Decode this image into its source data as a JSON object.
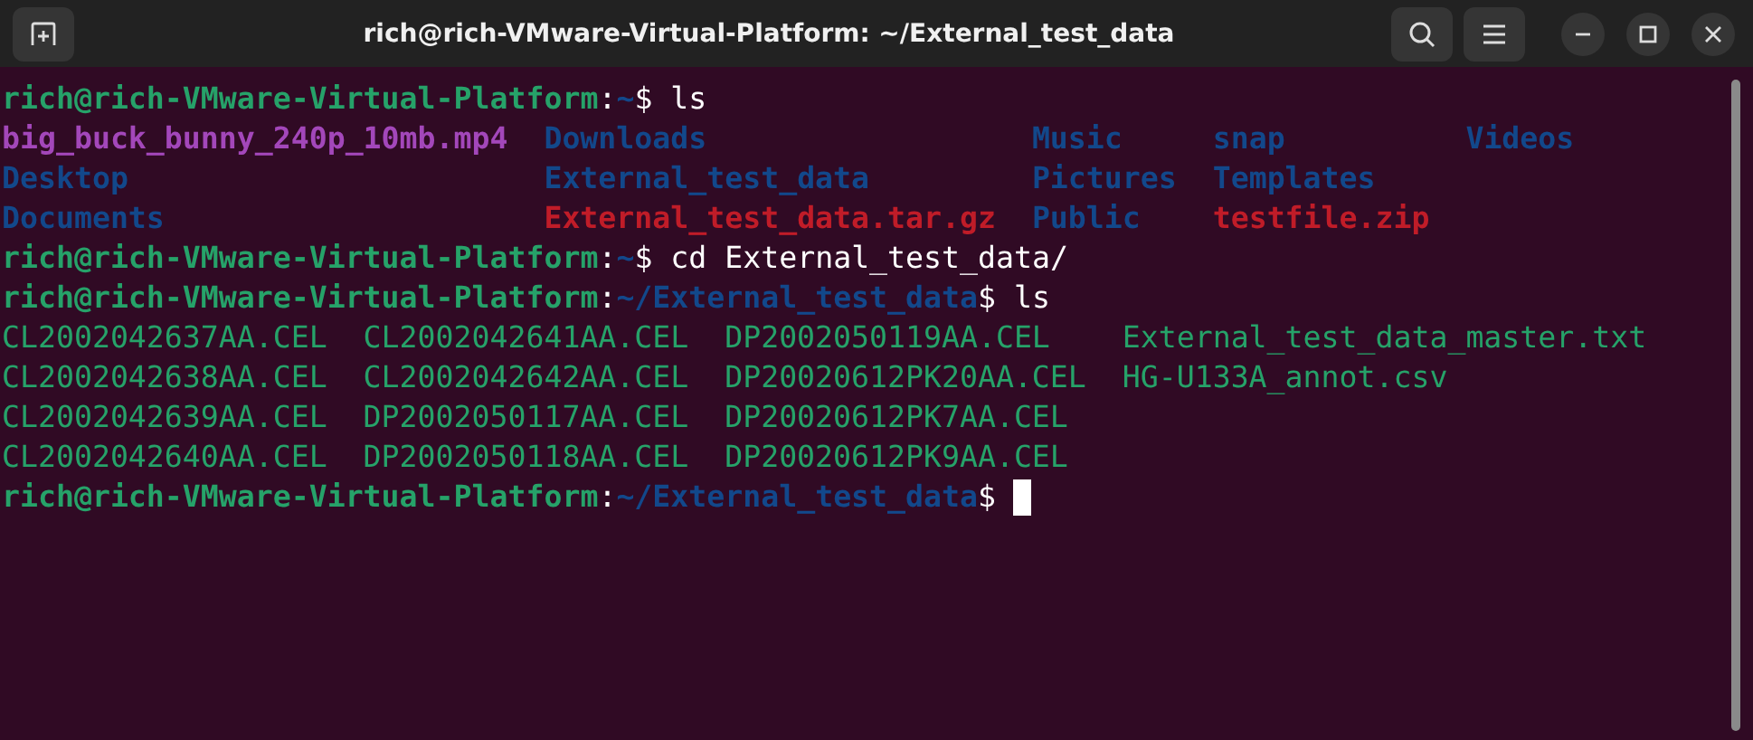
{
  "window": {
    "title": "rich@rich-VMware-Virtual-Platform: ~/External_test_data"
  },
  "lines": [
    {
      "kind": "prompt",
      "segments": [
        {
          "kind": "user",
          "text": "rich@rich-VMware-Virtual-Platform"
        },
        {
          "kind": "plain",
          "text": ":"
        },
        {
          "kind": "path",
          "text": "~"
        },
        {
          "kind": "plain",
          "text": "$ ls"
        }
      ]
    },
    {
      "kind": "listing",
      "rows": [
        [
          {
            "kind": "media",
            "text": "big_buck_bunny_240p_10mb.mp4"
          },
          {
            "kind": "dir",
            "text": "Downloads"
          },
          {
            "kind": "dir",
            "text": "Music"
          },
          {
            "kind": "dir",
            "text": "snap"
          },
          {
            "kind": "dir",
            "text": "Videos"
          }
        ],
        [
          {
            "kind": "dir",
            "text": "Desktop"
          },
          {
            "kind": "dir",
            "text": "External_test_data"
          },
          {
            "kind": "dir",
            "text": "Pictures"
          },
          {
            "kind": "dir",
            "text": "Templates"
          }
        ],
        [
          {
            "kind": "dir",
            "text": "Documents"
          },
          {
            "kind": "archive",
            "text": "External_test_data.tar.gz"
          },
          {
            "kind": "dir",
            "text": "Public"
          },
          {
            "kind": "archive",
            "text": "testfile.zip"
          }
        ]
      ]
    },
    {
      "kind": "prompt",
      "segments": [
        {
          "kind": "user",
          "text": "rich@rich-VMware-Virtual-Platform"
        },
        {
          "kind": "plain",
          "text": ":"
        },
        {
          "kind": "path",
          "text": "~"
        },
        {
          "kind": "plain",
          "text": "$ cd External_test_data/"
        }
      ]
    },
    {
      "kind": "prompt",
      "segments": [
        {
          "kind": "user",
          "text": "rich@rich-VMware-Virtual-Platform"
        },
        {
          "kind": "plain",
          "text": ":"
        },
        {
          "kind": "path",
          "text": "~/External_test_data"
        },
        {
          "kind": "plain",
          "text": "$ ls"
        }
      ]
    },
    {
      "kind": "listing",
      "rows": [
        [
          {
            "kind": "file",
            "text": "CL2002042637AA.CEL"
          },
          {
            "kind": "file",
            "text": "CL2002042641AA.CEL"
          },
          {
            "kind": "file",
            "text": "DP2002050119AA.CEL"
          },
          {
            "kind": "file",
            "text": "External_test_data_master.txt"
          }
        ],
        [
          {
            "kind": "file",
            "text": "CL2002042638AA.CEL"
          },
          {
            "kind": "file",
            "text": "CL2002042642AA.CEL"
          },
          {
            "kind": "file",
            "text": "DP20020612PK20AA.CEL"
          },
          {
            "kind": "file",
            "text": "HG-U133A_annot.csv"
          }
        ],
        [
          {
            "kind": "file",
            "text": "CL2002042639AA.CEL"
          },
          {
            "kind": "file",
            "text": "DP2002050117AA.CEL"
          },
          {
            "kind": "file",
            "text": "DP20020612PK7AA.CEL"
          }
        ],
        [
          {
            "kind": "file",
            "text": "CL2002042640AA.CEL"
          },
          {
            "kind": "file",
            "text": "DP2002050118AA.CEL"
          },
          {
            "kind": "file",
            "text": "DP20020612PK9AA.CEL"
          }
        ]
      ]
    },
    {
      "kind": "prompt",
      "cursor": true,
      "segments": [
        {
          "kind": "user",
          "text": "rich@rich-VMware-Virtual-Platform"
        },
        {
          "kind": "plain",
          "text": ":"
        },
        {
          "kind": "path",
          "text": "~/External_test_data"
        },
        {
          "kind": "plain",
          "text": "$ "
        }
      ]
    }
  ]
}
